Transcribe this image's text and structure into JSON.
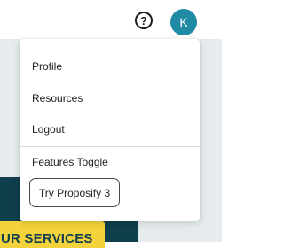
{
  "header": {
    "help_icon_glyph": "?",
    "avatar_initial": "K"
  },
  "user_menu": {
    "items": [
      {
        "label": "Profile"
      },
      {
        "label": "Resources"
      },
      {
        "label": "Logout"
      },
      {
        "label": "Features Toggle"
      }
    ],
    "try_button_label": "Try Proposify 3"
  },
  "background": {
    "services_button_label": "UR SERVICES"
  },
  "colors": {
    "avatar_bg": "#1f8aa3",
    "dark_panel": "#0f3e4d",
    "services_button_bg": "#f3d23b",
    "page_bg": "#e6ecee"
  }
}
